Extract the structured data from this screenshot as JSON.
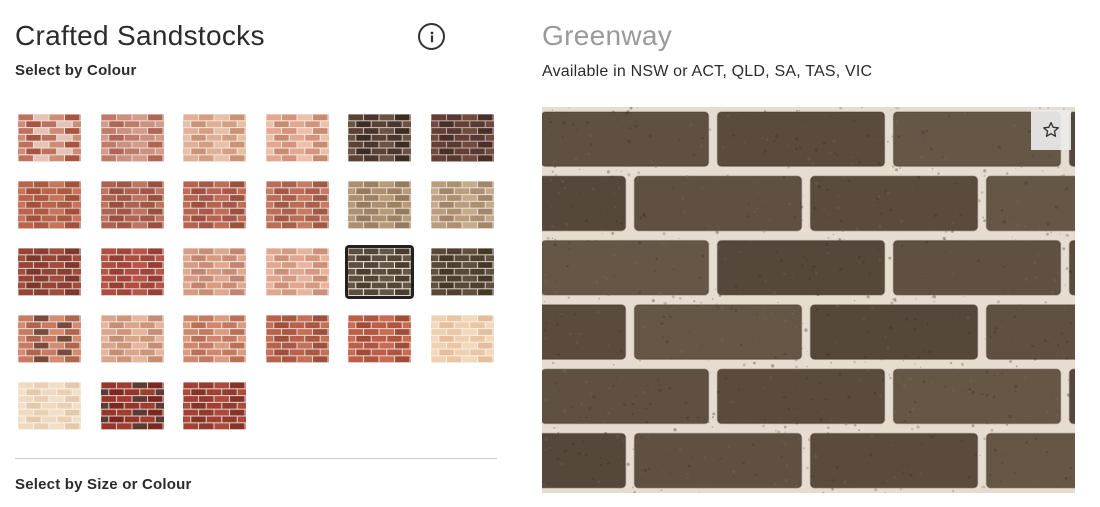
{
  "range": {
    "title": "Crafted Sandstocks",
    "select_by_colour_label": "Select by Colour",
    "select_by_size_label": "Select by Size or Colour"
  },
  "icons": {
    "info": "info-icon",
    "favourite": "star-outline-icon"
  },
  "swatches": [
    {
      "base": "#b9624f",
      "brick_colors": [
        "#c0705c",
        "#a8543f",
        "#d08a76",
        "#e7c3b6"
      ],
      "mortar": "#e9e1dc",
      "selected": false
    },
    {
      "base": "#b97464",
      "brick_colors": [
        "#c27a68",
        "#b26455",
        "#d89a88",
        "#cf8f7f"
      ],
      "mortar": "#e4d8d2",
      "selected": false
    },
    {
      "base": "#d8a488",
      "brick_colors": [
        "#e0b096",
        "#cc9274",
        "#e8c0a8",
        "#d69d80"
      ],
      "mortar": "#efe4da",
      "selected": false
    },
    {
      "base": "#d99a82",
      "brick_colors": [
        "#e4a78f",
        "#c98a72",
        "#efc0a8",
        "#d6927a"
      ],
      "mortar": "#f1e6de",
      "selected": false
    },
    {
      "base": "#4e3a30",
      "brick_colors": [
        "#5a4236",
        "#3d2c24",
        "#6a5244",
        "#4a362c"
      ],
      "mortar": "#c9bdb2",
      "selected": false
    },
    {
      "base": "#5b3a32",
      "brick_colors": [
        "#643f36",
        "#4a2e28",
        "#73493e",
        "#583832"
      ],
      "mortar": "#b8aaa2",
      "selected": false
    },
    {
      "base": "#b45c45",
      "brick_colors": [
        "#bd634b",
        "#a64f39",
        "#c9735b",
        "#ad5840"
      ],
      "mortar": "#d4c5ba",
      "selected": false
    },
    {
      "base": "#a95a4a",
      "brick_colors": [
        "#b0614f",
        "#99503f",
        "#c0735f",
        "#a35645"
      ],
      "mortar": "#d8cbc3",
      "selected": false
    },
    {
      "base": "#b05a48",
      "brick_colors": [
        "#b9634f",
        "#9f4f3e",
        "#c26c56",
        "#a8574a"
      ],
      "mortar": "#e0d4cc",
      "selected": false
    },
    {
      "base": "#b36550",
      "brick_colors": [
        "#bd6d57",
        "#a25a47",
        "#c97a62",
        "#ac604c"
      ],
      "mortar": "#e2d5cc",
      "selected": false
    },
    {
      "base": "#a48667",
      "brick_colors": [
        "#ad8e6e",
        "#967a5c",
        "#b89a78",
        "#9e8162"
      ],
      "mortar": "#e2d8cc",
      "selected": false
    },
    {
      "base": "#b19375",
      "brick_colors": [
        "#bb9d7e",
        "#a3866a",
        "#c6aa8a",
        "#ad8f71"
      ],
      "mortar": "#e6ddd2",
      "selected": false
    },
    {
      "base": "#8f3f32",
      "brick_colors": [
        "#974436",
        "#7f372b",
        "#a14c3d",
        "#8a3d31"
      ],
      "mortar": "#d6c9c1",
      "selected": false
    },
    {
      "base": "#a8473c",
      "brick_colors": [
        "#b04c40",
        "#983f35",
        "#b95448",
        "#a2453a"
      ],
      "mortar": "#e2d4cd",
      "selected": false
    },
    {
      "base": "#d0917a",
      "brick_colors": [
        "#d99a82",
        "#c38470",
        "#e2a88f",
        "#cb8c76"
      ],
      "mortar": "#efe3dc",
      "selected": false
    },
    {
      "base": "#d99d85",
      "brick_colors": [
        "#e1a68e",
        "#cc9079",
        "#eab49c",
        "#d59880"
      ],
      "mortar": "#f1e6df",
      "selected": false
    },
    {
      "base": "#564839",
      "brick_colors": [
        "#5d4e3f",
        "#4b3e31",
        "#665646",
        "#534537"
      ],
      "mortar": "#e9e2d6",
      "selected": true
    },
    {
      "base": "#4f4132",
      "brick_colors": [
        "#574838",
        "#44382b",
        "#60503f",
        "#4d3f31"
      ],
      "mortar": "#cfc5b6",
      "selected": false
    },
    {
      "base": "#c07258",
      "brick_colors": [
        "#c97a60",
        "#b2654d",
        "#d68a70",
        "#7a4a3c"
      ],
      "mortar": "#e2d7d0",
      "selected": false
    },
    {
      "base": "#d29a80",
      "brick_colors": [
        "#dca48a",
        "#c58d74",
        "#e6b59c",
        "#cf9579"
      ],
      "mortar": "#ede2da",
      "selected": false
    },
    {
      "base": "#c97e64",
      "brick_colors": [
        "#d2876c",
        "#bb7158",
        "#dc9a80",
        "#c47a60"
      ],
      "mortar": "#ede2db",
      "selected": false
    },
    {
      "base": "#b35a45",
      "brick_colors": [
        "#bb614b",
        "#a14e3b",
        "#c66f57",
        "#ab5742"
      ],
      "mortar": "#ddd0c8",
      "selected": false
    },
    {
      "base": "#b6553f",
      "brick_colors": [
        "#c05d46",
        "#a44b37",
        "#ca6a52",
        "#b05540"
      ],
      "mortar": "#e2d5cc",
      "selected": false
    },
    {
      "base": "#edc9a8",
      "brick_colors": [
        "#f1d0b0",
        "#e6be9b",
        "#f4d8bb",
        "#ebc6a4"
      ],
      "mortar": "#f7efe5",
      "selected": false
    },
    {
      "base": "#ecd3b8",
      "brick_colors": [
        "#f0d9bf",
        "#e5c9ac",
        "#f3dfc7",
        "#eacfb4"
      ],
      "mortar": "#f8f1e8",
      "selected": false
    },
    {
      "base": "#8e2f26",
      "brick_colors": [
        "#983429",
        "#7c2820",
        "#5e3a34",
        "#a33c30"
      ],
      "mortar": "#d3c6be",
      "selected": false
    },
    {
      "base": "#9a3a2e",
      "brick_colors": [
        "#a34033",
        "#883328",
        "#ae4a3b",
        "#943a2e"
      ],
      "mortar": "#d9cdc6",
      "selected": false
    }
  ],
  "selected_brick": {
    "name": "Greenway",
    "availability": "Available in NSW or ACT, QLD, SA, TAS, VIC",
    "colors": {
      "mortar": "#e6ddd0",
      "brick_a": "#5f5042",
      "brick_b": "#554739",
      "brick_c": "#665645",
      "brick_d": "#5a4b3d",
      "shadow": "#3e3329"
    }
  }
}
